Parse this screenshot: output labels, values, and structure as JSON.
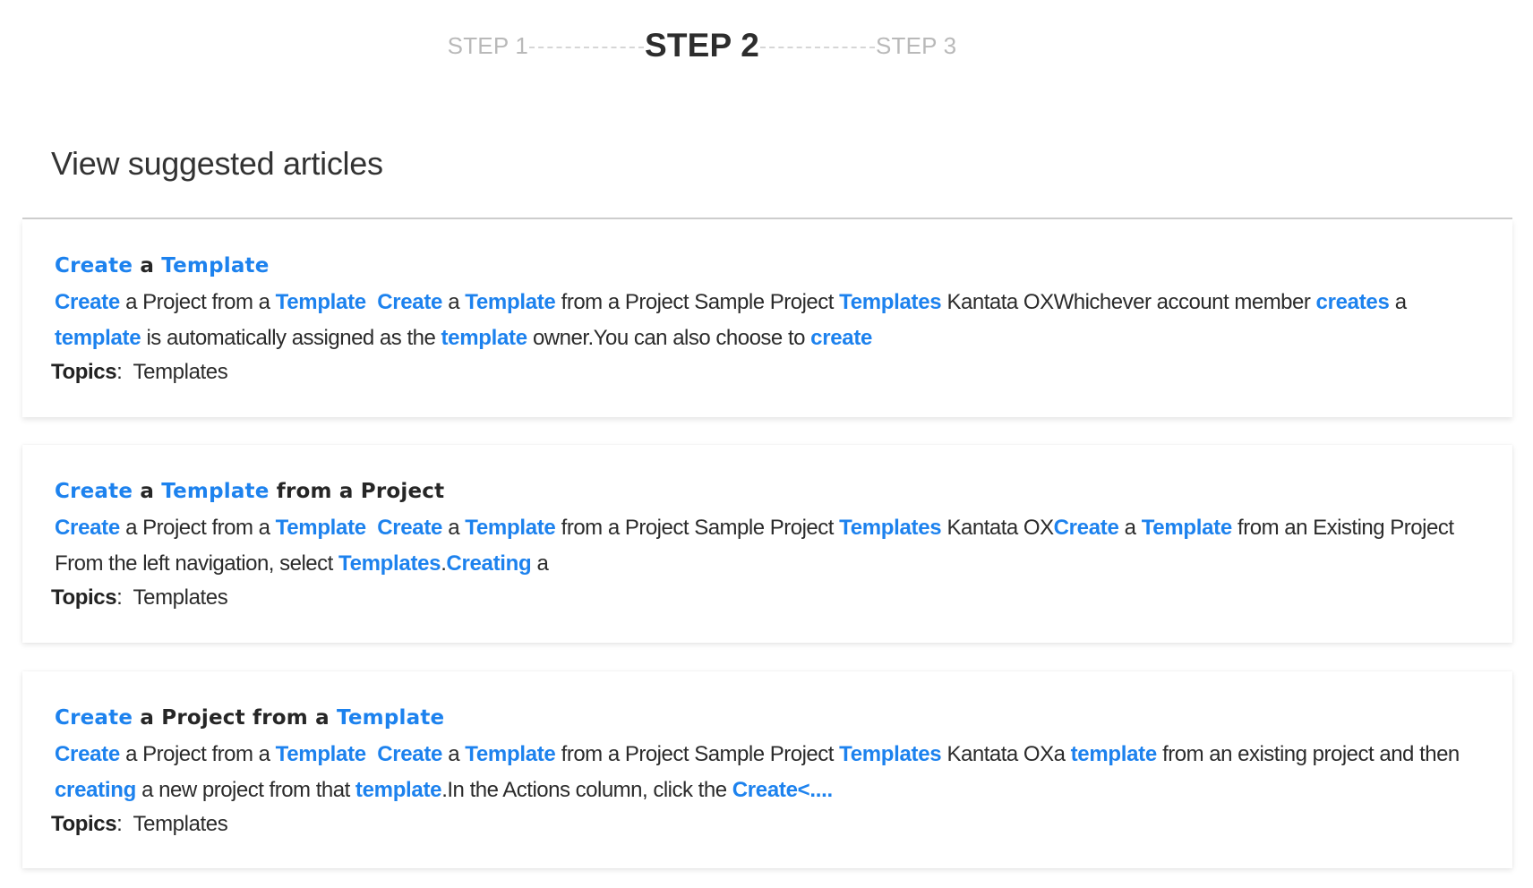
{
  "steps": [
    {
      "label": "STEP 1",
      "state": "inactive"
    },
    {
      "label": "STEP 2",
      "state": "active"
    },
    {
      "label": "STEP 3",
      "state": "inactive"
    }
  ],
  "section": {
    "title": "View suggested articles"
  },
  "colors": {
    "highlight": "#1d82ee",
    "text": "#333333",
    "step_inactive": "#b9b9b9",
    "step_active": "#2d2d2d"
  },
  "articles": [
    {
      "title": [
        {
          "t": "Create",
          "hl": true
        },
        {
          "t": " a ",
          "hl": false
        },
        {
          "t": "Template",
          "hl": true
        }
      ],
      "snippet": [
        {
          "t": "Create",
          "hl": true
        },
        {
          "t": " a Project from a ",
          "hl": false
        },
        {
          "t": "Template",
          "hl": true
        },
        {
          "t": "  ",
          "hl": false
        },
        {
          "t": "Create",
          "hl": true
        },
        {
          "t": " a ",
          "hl": false
        },
        {
          "t": "Template",
          "hl": true
        },
        {
          "t": " from a Project Sample Project ",
          "hl": false
        },
        {
          "t": "Templates",
          "hl": true
        },
        {
          "t": " Kantata OXWhichever account member ",
          "hl": false
        },
        {
          "t": "creates",
          "hl": true
        },
        {
          "t": " a ",
          "hl": false
        },
        {
          "t": "template",
          "hl": true
        },
        {
          "t": " is automatically assigned as the ",
          "hl": false
        },
        {
          "t": "template",
          "hl": true
        },
        {
          "t": " owner.You can also choose to ",
          "hl": false
        },
        {
          "t": "create",
          "hl": true
        }
      ],
      "topics_label": "Topics",
      "topics_value": "Templates"
    },
    {
      "title": [
        {
          "t": "Create",
          "hl": true
        },
        {
          "t": " a ",
          "hl": false
        },
        {
          "t": "Template",
          "hl": true
        },
        {
          "t": " from a Project",
          "hl": false
        }
      ],
      "snippet": [
        {
          "t": "Create",
          "hl": true
        },
        {
          "t": " a Project from a ",
          "hl": false
        },
        {
          "t": "Template",
          "hl": true
        },
        {
          "t": "  ",
          "hl": false
        },
        {
          "t": "Create",
          "hl": true
        },
        {
          "t": " a ",
          "hl": false
        },
        {
          "t": "Template",
          "hl": true
        },
        {
          "t": " from a Project Sample Project ",
          "hl": false
        },
        {
          "t": "Templates",
          "hl": true
        },
        {
          "t": " Kantata OX",
          "hl": false
        },
        {
          "t": "Create",
          "hl": true
        },
        {
          "t": " a ",
          "hl": false
        },
        {
          "t": "Template",
          "hl": true
        },
        {
          "t": " from an Existing Project From the left navigation, select ",
          "hl": false
        },
        {
          "t": "Templates",
          "hl": true
        },
        {
          "t": ".",
          "hl": false
        },
        {
          "t": "Creating",
          "hl": true
        },
        {
          "t": " a",
          "hl": false
        }
      ],
      "topics_label": "Topics",
      "topics_value": "Templates"
    },
    {
      "title": [
        {
          "t": "Create",
          "hl": true
        },
        {
          "t": " a Project from a ",
          "hl": false
        },
        {
          "t": "Template",
          "hl": true
        }
      ],
      "snippet": [
        {
          "t": "Create",
          "hl": true
        },
        {
          "t": " a Project from a ",
          "hl": false
        },
        {
          "t": "Template",
          "hl": true
        },
        {
          "t": "  ",
          "hl": false
        },
        {
          "t": "Create",
          "hl": true
        },
        {
          "t": " a ",
          "hl": false
        },
        {
          "t": "Template",
          "hl": true
        },
        {
          "t": " from a Project Sample Project ",
          "hl": false
        },
        {
          "t": "Templates",
          "hl": true
        },
        {
          "t": " Kantata OXa ",
          "hl": false
        },
        {
          "t": "template",
          "hl": true
        },
        {
          "t": " from an existing project and then ",
          "hl": false
        },
        {
          "t": "creating",
          "hl": true
        },
        {
          "t": " a new project from that ",
          "hl": false
        },
        {
          "t": "template",
          "hl": true
        },
        {
          "t": ".In the Actions column, click the ",
          "hl": false
        },
        {
          "t": "Create<....",
          "hl": true
        }
      ],
      "topics_label": "Topics",
      "topics_value": "Templates"
    }
  ]
}
